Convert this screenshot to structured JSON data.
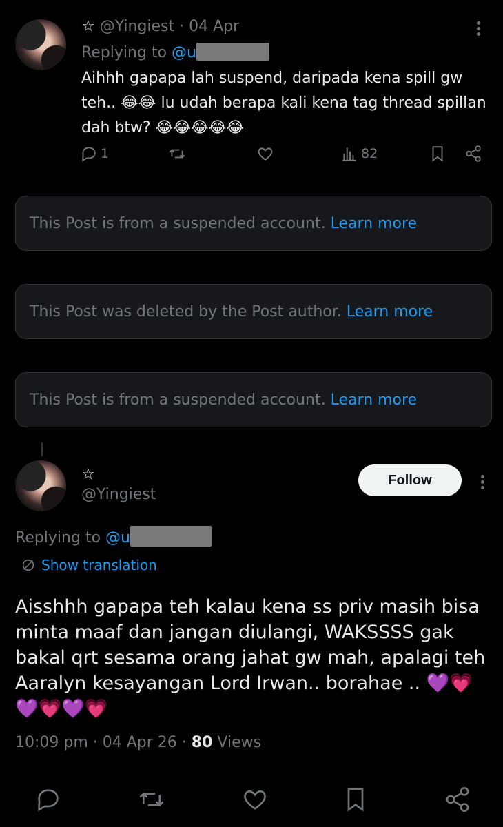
{
  "tweet1": {
    "star": "☆",
    "handle": "@Yingiest",
    "date": "· 04 Apr",
    "replying_prefix": "Replying to ",
    "replying_handle": "@u",
    "text_line1": "Aihhh gapapa lah suspend, daripada kena spill gw",
    "text_line2": "teh.. 😂😂 lu udah berapa kali kena tag thread spillan",
    "text_line3": "dah btw? 😂😂😂😂😂",
    "reply_count": "1",
    "views": "82"
  },
  "notices": [
    {
      "text": "This Post is from a suspended account. ",
      "link": "Learn more"
    },
    {
      "text": "This Post was deleted by the Post author. ",
      "link": "Learn more"
    },
    {
      "text": "This Post is from a suspended account. ",
      "link": "Learn more"
    }
  ],
  "tweet2": {
    "star": "☆",
    "handle": "@Yingiest",
    "follow_label": "Follow",
    "replying_prefix": "Replying to ",
    "replying_handle": "@u",
    "show_translation": "Show translation",
    "text": "Aisshhh gapapa teh kalau kena ss priv masih bisa minta maaf dan jangan diulangi, WAKSSSS gak bakal qrt sesama orang jahat gw mah, apalagi teh Aaralyn kesayangan Lord Irwan.. borahae .. 💜💗💜💗💜💗",
    "time": "10:09 pm · 04 Apr 26 · ",
    "views_count": "80",
    "views_label": " Views"
  },
  "colors": {
    "background": "#000000",
    "text": "#e7e9ea",
    "muted": "#71767b",
    "link": "#1d9bf0",
    "notice_bg": "#16181c"
  },
  "icons": [
    "reply-icon",
    "retweet-icon",
    "like-icon",
    "views-icon",
    "bookmark-icon",
    "share-icon",
    "more-icon",
    "translate-icon"
  ]
}
